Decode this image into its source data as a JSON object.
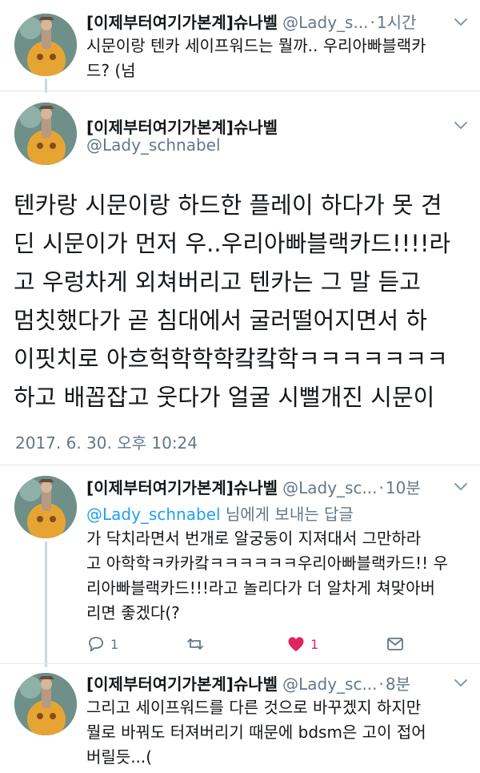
{
  "tweets": [
    {
      "name": "[이제부터여기가본계]슈나벨",
      "handle": "@Lady_s...",
      "separator": "·",
      "time": "1시간",
      "text_lines": [
        "시문이랑 텐카 세이프워드는 뭘까.. 우리아빠블랙카",
        "드? (넘"
      ]
    },
    {
      "name": "[이제부터여기가본계]슈나벨",
      "handle": "@Lady_schnabel",
      "text_lines": [
        "텐카랑 시문이랑 하드한 플레이 하다가 못 견",
        "딘 시문이가 먼저 우..우리아빠블랙카드!!!!라",
        "고 우렁차게 외쳐버리고 텐카는 그 말 듣고",
        "멈칫했다가 곧 침대에서 굴러떨어지면서 하",
        "이핏치로 아흐헉학학학캌캌학ㅋㅋㅋㅋㅋㅋㅋ",
        "하고 배꼽잡고 웃다가 얼굴 시뻘개진 시문이"
      ],
      "date": "2017. 6. 30. 오후 10:24"
    },
    {
      "name": "[이제부터여기가본계]슈나벨",
      "handle": "@Lady_sc...",
      "separator": "·",
      "time": "10분",
      "reply_to_mention": "@Lady_schnabel",
      "reply_to_suffix": " 님에게 보내는 답글",
      "text_lines": [
        "가 닥치라면서 번개로 알궁둥이 지져대서 그만하라",
        "고 아학학ㅋ카카캌ㅋㅋㅋㅋㅋㅋ우리아빠블랙카드!! 우",
        "리아빠블랙카드!!!라고 놀리다가 더 알차게 쳐맞아버",
        "리면 좋겠다(?"
      ],
      "actions": {
        "reply_count": "1",
        "retweet_count": "",
        "like_count": "1"
      }
    },
    {
      "name": "[이제부터여기가본계]슈나벨",
      "handle": "@Lady_sc...",
      "separator": "·",
      "time": "8분",
      "text_lines": [
        "그리고 세이프워드를 다른 것으로 바꾸겠지 하지만",
        "뭘로 바꿔도 터져버리기 때문에 bdsm은 고이 접어",
        "버릴듯...("
      ]
    }
  ],
  "icons": {
    "reply": "reply-icon",
    "retweet": "retweet-icon",
    "like": "heart-icon",
    "dm": "envelope-icon",
    "more": "chevron-down-icon"
  },
  "colors": {
    "name": "#14171a",
    "secondary": "#657786",
    "link": "#1da1f2",
    "like": "#e0245e",
    "thread_line": "#ccd6dd",
    "divider": "#e1e8ed"
  }
}
